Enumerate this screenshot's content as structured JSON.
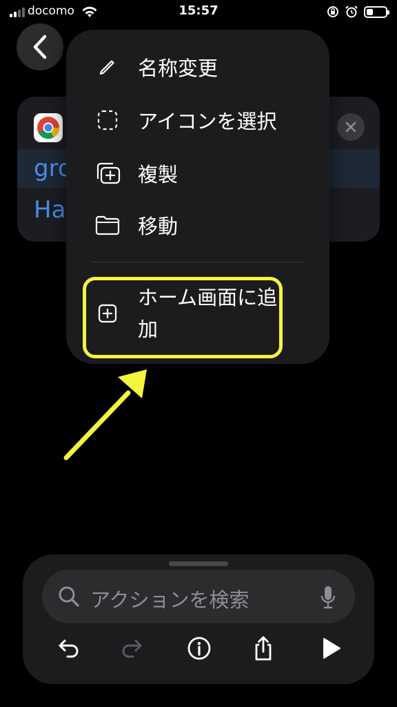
{
  "status_bar": {
    "carrier": "docomo",
    "time": "15:57",
    "battery_level": 0.35,
    "icons": [
      "signal-icon",
      "wifi-icon",
      "rotation-lock-icon",
      "alarm-icon",
      "battery-icon"
    ]
  },
  "background_card": {
    "line1": "gro",
    "line2": "Ha",
    "link_color": "#4a8ee8"
  },
  "menu": {
    "items": [
      {
        "label": "名称変更",
        "icon": "pencil-icon"
      },
      {
        "label": "アイコンを選択",
        "icon": "dashed-square-icon"
      },
      {
        "label": "複製",
        "icon": "duplicate-icon"
      },
      {
        "label": "移動",
        "icon": "folder-icon"
      },
      {
        "label": "ホーム画面に追加",
        "icon": "plus-square-icon"
      }
    ]
  },
  "annotation": {
    "highlight_color": "#f5f43f"
  },
  "bottom": {
    "search_placeholder": "アクションを検索",
    "toolbar": [
      "undo-icon",
      "redo-icon",
      "info-icon",
      "share-icon",
      "play-icon"
    ]
  }
}
